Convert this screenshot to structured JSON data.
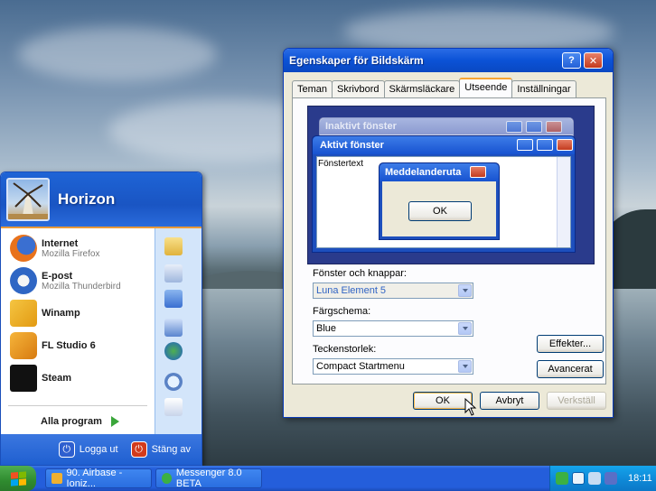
{
  "colors": {
    "accent": "#245edb",
    "start_green": "#2f8b2f",
    "dialog_bg": "#ece9d8"
  },
  "start_menu": {
    "user": "Horizon",
    "items": [
      {
        "title": "Internet",
        "subtitle": "Mozilla Firefox",
        "icon": "firefox-icon"
      },
      {
        "title": "E-post",
        "subtitle": "Mozilla Thunderbird",
        "icon": "thunderbird-icon"
      },
      {
        "title": "Winamp",
        "subtitle": "",
        "icon": "winamp-icon"
      },
      {
        "title": "FL Studio 6",
        "subtitle": "",
        "icon": "fl-studio-icon"
      },
      {
        "title": "Steam",
        "subtitle": "",
        "icon": "steam-icon"
      }
    ],
    "all_programs": "Alla program",
    "logoff": "Logga ut",
    "shutdown": "Stäng av"
  },
  "dialog": {
    "title": "Egenskaper för Bildskärm",
    "help_btn": "?",
    "close_btn": "✕",
    "tabs": [
      "Teman",
      "Skrivbord",
      "Skärmsläckare",
      "Utseende",
      "Inställningar"
    ],
    "active_tab": "Utseende",
    "preview": {
      "inactive_title": "Inaktivt fönster",
      "active_title": "Aktivt fönster",
      "window_text": "Fönstertext",
      "msgbox_title": "Meddelanderuta",
      "msgbox_ok": "OK"
    },
    "windows_buttons_label": "Fönster och knappar:",
    "windows_buttons_value": "Luna Element 5",
    "color_scheme_label": "Färgschema:",
    "color_scheme_value": "Blue",
    "font_size_label": "Teckenstorlek:",
    "font_size_value": "Compact Startmenu",
    "effects_btn": "Effekter...",
    "advanced_btn": "Avancerat",
    "ok_btn": "OK",
    "cancel_btn": "Avbryt",
    "apply_btn": "Verkställ"
  },
  "taskbar": {
    "tasks": [
      {
        "label": "90. Airbase - Ioniz...",
        "icon": "winamp-icon"
      },
      {
        "label": "Messenger 8.0 BETA",
        "icon": "messenger-icon"
      }
    ],
    "clock": "18:11"
  }
}
